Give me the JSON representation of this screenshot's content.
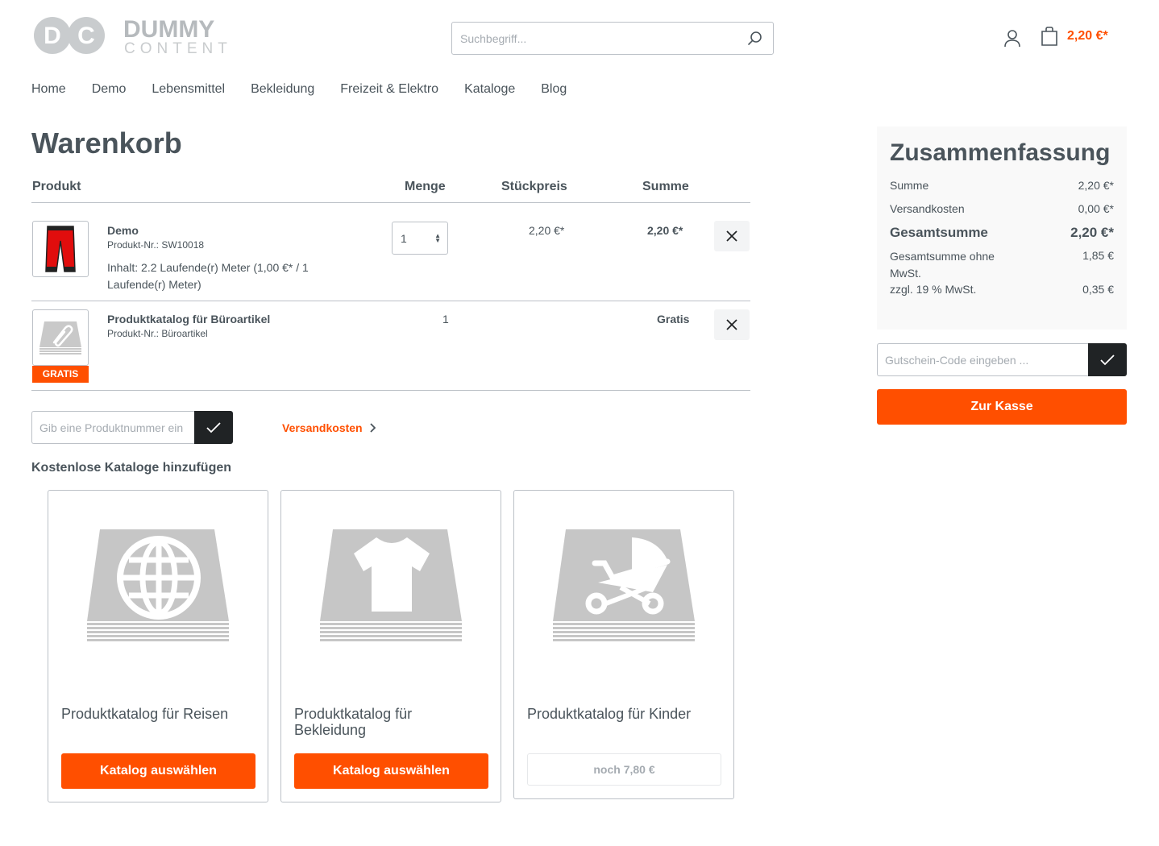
{
  "header": {
    "logo_mark": "DC",
    "logo_line1": "DUMMY",
    "logo_line2": "CONTENT",
    "search_placeholder": "Suchbegriff...",
    "cart_total": "2,20 €*"
  },
  "nav": {
    "items": [
      "Home",
      "Demo",
      "Lebensmittel",
      "Bekleidung",
      "Freizeit & Elektro",
      "Kataloge",
      "Blog"
    ]
  },
  "cart": {
    "title": "Warenkorb",
    "columns": {
      "product": "Produkt",
      "quantity": "Menge",
      "unit_price": "Stückpreis",
      "total": "Summe"
    },
    "items": [
      {
        "name": "Demo",
        "sku": "Produkt-Nr.: SW10018",
        "content": "Inhalt: 2.2 Laufende(r) Meter (1,00 €* / 1 Laufende(r) Meter)",
        "quantity": "1",
        "unit_price": "2,20 €*",
        "total": "2,20 €*"
      },
      {
        "name": "Produktkatalog für Büroartikel",
        "sku": "Produkt-Nr.: Büroartikel",
        "badge": "GRATIS",
        "quantity": "1",
        "total": "Gratis"
      }
    ],
    "add_product_placeholder": "Gib eine Produktnummer ein",
    "shipping_link": "Versandkosten"
  },
  "catalogs": {
    "heading": "Kostenlose Kataloge hinzufügen",
    "items": [
      {
        "title": "Produktkatalog für Reisen",
        "button": "Katalog auswählen",
        "icon": "globe-icon"
      },
      {
        "title": "Produktkatalog für Bekleidung",
        "button": "Katalog auswählen",
        "icon": "shirt-icon"
      },
      {
        "title": "Produktkatalog für Kinder",
        "button": "noch 7,80 €",
        "icon": "stroller-icon"
      }
    ]
  },
  "summary": {
    "title": "Zusammenfassung",
    "sum_label": "Summe",
    "sum_value": "2,20 €*",
    "shipping_label": "Versandkosten",
    "shipping_value": "0,00 €*",
    "grand_label": "Gesamtsumme",
    "grand_value": "2,20 €*",
    "net_label": "Gesamtsumme ohne MwSt.",
    "net_value": "1,85 €",
    "tax_label": "zzgl. 19 % MwSt.",
    "tax_value": "0,35 €",
    "voucher_placeholder": "Gutschein-Code eingeben ...",
    "checkout_button": "Zur Kasse"
  },
  "colors": {
    "accent": "#ff4f00",
    "text": "#4a545b",
    "dark": "#202325",
    "border": "#bcc1c7"
  }
}
